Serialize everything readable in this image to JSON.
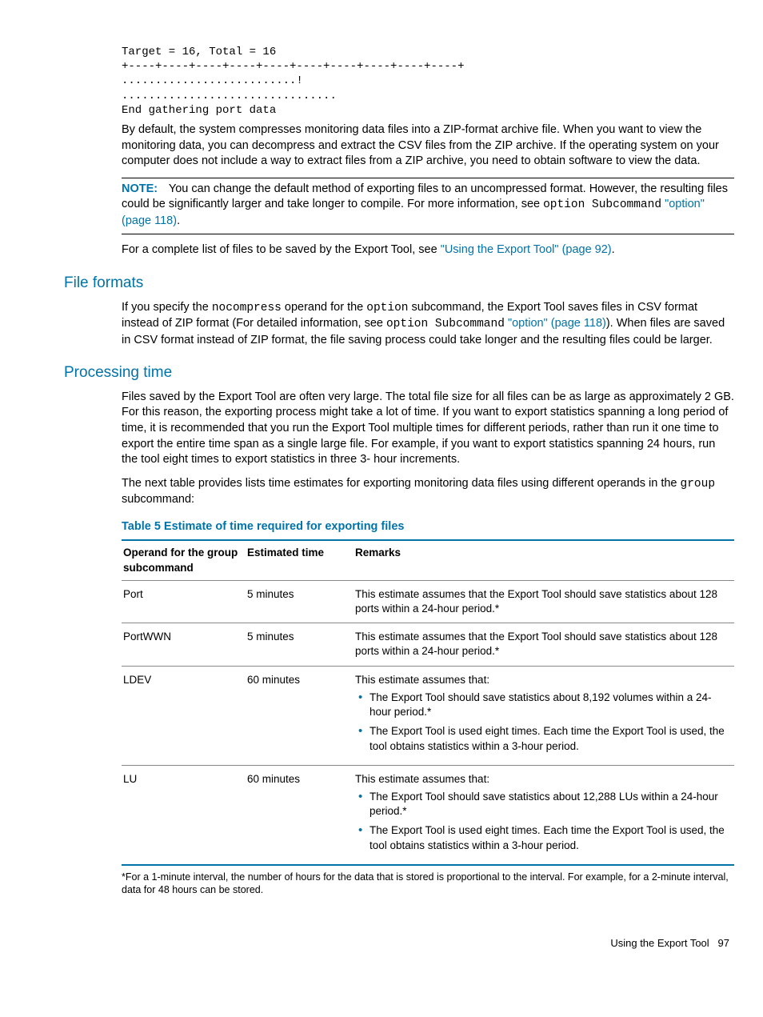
{
  "code_block": "Target = 16, Total = 16\n+----+----+----+----+----+----+----+----+----+----+\n..........................!\n................................\nEnd gathering port data",
  "para_default": "By default, the system compresses monitoring data files into a ZIP-format archive file. When you want to view the monitoring data, you can decompress and extract the CSV files from the ZIP archive. If the operating system on your computer does not include a way to extract files from a ZIP archive, you need to obtain software to view the data.",
  "note_label": "NOTE:",
  "note_text_1": "You can change the default method of exporting files to an uncompressed format. However, the resulting files could be significantly larger and take longer to compile. For more information, see ",
  "note_code": "option Subcommand",
  "note_link": " \"option\" (page 118)",
  "note_end": ".",
  "complete_list_1": "For a complete list of files to be saved by the Export Tool, see ",
  "complete_list_link": "\"Using the Export Tool\" (page 92)",
  "complete_list_end": ".",
  "h_file_formats": "File formats",
  "ff_1a": "If you specify the ",
  "ff_code1": "nocompress",
  "ff_1b": " operand for the ",
  "ff_code2": "option",
  "ff_1c": " subcommand, the Export Tool saves files in CSV format instead of ZIP format (For detailed information, see ",
  "ff_code3": "option Subcommand",
  "ff_link": " \"option\" (page 118)",
  "ff_1d": "). When files are saved in CSV format instead of ZIP format, the file saving process could take longer and the resulting files could be larger.",
  "h_processing": "Processing time",
  "pt_para1": "Files saved by the Export Tool are often very large. The total file size for all files can be as large as approximately 2 GB. For this reason, the exporting process might take a lot of time. If you want to export statistics spanning a long period of time, it is recommended that you run the Export Tool multiple times for different periods, rather than run it one time to export the entire time span as a single large file. For example, if you want to export statistics spanning 24 hours, run the tool eight times to export statistics in three 3- hour increments.",
  "pt_para2a": "The next table provides lists time estimates for exporting monitoring data files using different operands in the ",
  "pt_code": "group",
  "pt_para2b": " subcommand:",
  "table_title": "Table 5 Estimate of time required for exporting files",
  "th_operand": "Operand for the group subcommand",
  "th_time": "Estimated time",
  "th_remarks": "Remarks",
  "rows": [
    {
      "op": "Port",
      "time": "5 minutes",
      "rem_text": "This estimate assumes that the Export Tool should save statistics about 128 ports within a 24-hour period.*"
    },
    {
      "op": "PortWWN",
      "time": "5 minutes",
      "rem_text": "This estimate assumes that the Export Tool should save statistics about 128 ports within a 24-hour period.*"
    },
    {
      "op": "LDEV",
      "time": "60 minutes",
      "rem_intro": "This estimate assumes that:",
      "rem_b1": "The Export Tool should save statistics about 8,192 volumes within a 24-hour period.*",
      "rem_b2": "The Export Tool is used eight times. Each time the Export Tool is used, the tool obtains statistics within a 3-hour period."
    },
    {
      "op": "LU",
      "time": "60 minutes",
      "rem_intro": "This estimate assumes that:",
      "rem_b1": "The Export Tool should save statistics about 12,288 LUs within a 24-hour period.*",
      "rem_b2": "The Export Tool is used eight times. Each time the Export Tool is used, the tool obtains statistics within a 3-hour period."
    }
  ],
  "footnote": "*For a 1-minute interval, the number of hours for the data that is stored is proportional to the interval. For example, for a 2-minute interval, data for 48 hours can be stored.",
  "footer_text": "Using the Export Tool",
  "footer_page": "97"
}
